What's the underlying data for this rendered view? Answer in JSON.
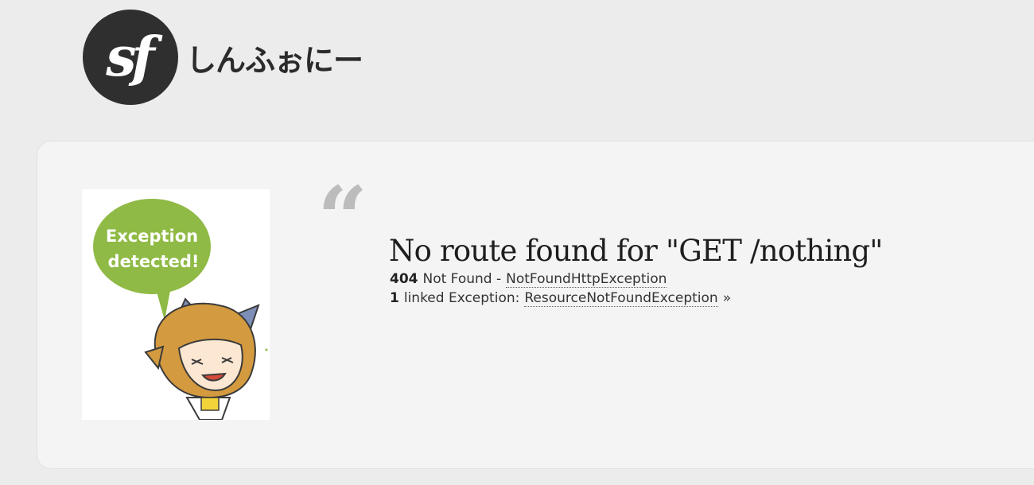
{
  "logo": {
    "mark": "sf",
    "text": "しんふぉにー"
  },
  "illustration": {
    "bubble_text_line1": "Exception",
    "bubble_text_line2": "detected!",
    "bubble_color": "#8fba45"
  },
  "quote_glyph": "“",
  "error": {
    "title": "No route found for \"GET /nothing\"",
    "status_code": "404",
    "status_text": "Not Found -",
    "exception_class": "NotFoundHttpException",
    "linked_count": "1",
    "linked_label": "linked Exception:",
    "linked_exception": "ResourceNotFoundException",
    "linked_suffix": "»"
  }
}
